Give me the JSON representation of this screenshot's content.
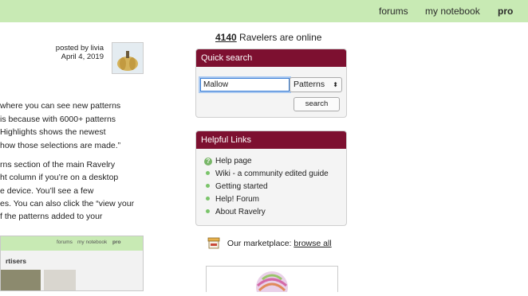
{
  "nav": {
    "forums": "forums",
    "notebook": "my notebook",
    "pro": "pro"
  },
  "post": {
    "posted_by": "posted by livia",
    "date": "April 4, 2019"
  },
  "body_lines": [
    "where you can see new patterns",
    "is because with 6000+ patterns",
    " Highlights shows the newest",
    "how those selections are made.”",
    "rns section of the main Ravelry",
    "ht column if you’re on a desktop",
    "e device. You’ll see a few",
    "es. You can also click the “view your",
    "f the patterns added to your"
  ],
  "screenshot": {
    "nav_forums": "forums",
    "nav_notebook": "my notebook",
    "nav_pro": "pro",
    "heading": "rtisers"
  },
  "online": {
    "count": "4140",
    "text": "Ravelers are online"
  },
  "quick_search": {
    "title": "Quick search",
    "query": "Mallow",
    "category": "Patterns",
    "button": "search"
  },
  "helpful_links": {
    "title": "Helpful Links",
    "items": [
      "Help page",
      "Wiki - a community edited guide",
      "Getting started",
      "Help! Forum",
      "About Ravelry"
    ]
  },
  "marketplace": {
    "label": "Our marketplace:",
    "link": "browse all"
  },
  "colors": {
    "topbar": "#c8eab4",
    "box_header": "#7d1030",
    "bullet": "#7ac46a"
  }
}
